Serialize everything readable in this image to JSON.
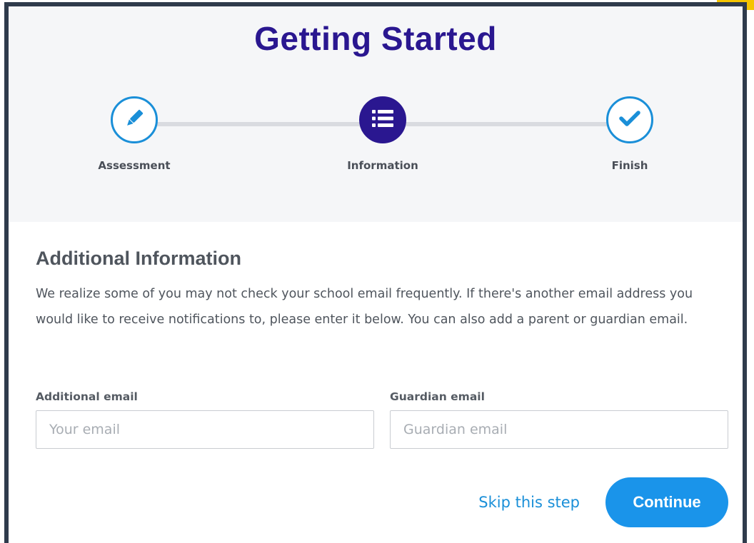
{
  "dialog": {
    "title": "Getting Started"
  },
  "stepper": {
    "steps": [
      {
        "label": "Assessment",
        "icon": "pencil-icon",
        "state": "completed"
      },
      {
        "label": "Information",
        "icon": "list-icon",
        "state": "active"
      },
      {
        "label": "Finish",
        "icon": "checkmark-icon",
        "state": "pending"
      }
    ]
  },
  "section": {
    "title": "Additional Information",
    "description": "We realize some of you may not check your school email frequently. If there's another email address you would like to receive notifications to, please enter it below. You can also add a parent or guardian email."
  },
  "fields": {
    "additional_email": {
      "label": "Additional email",
      "placeholder": "Your email",
      "value": ""
    },
    "guardian_email": {
      "label": "Guardian email",
      "placeholder": "Guardian email",
      "value": ""
    }
  },
  "actions": {
    "skip_label": "Skip this step",
    "continue_label": "Continue"
  },
  "colors": {
    "title": "#2a1790",
    "accent": "#1a94ea",
    "active_step": "#2a1790",
    "border": "#2f3b4c",
    "corner_accent": "#f5c400"
  }
}
